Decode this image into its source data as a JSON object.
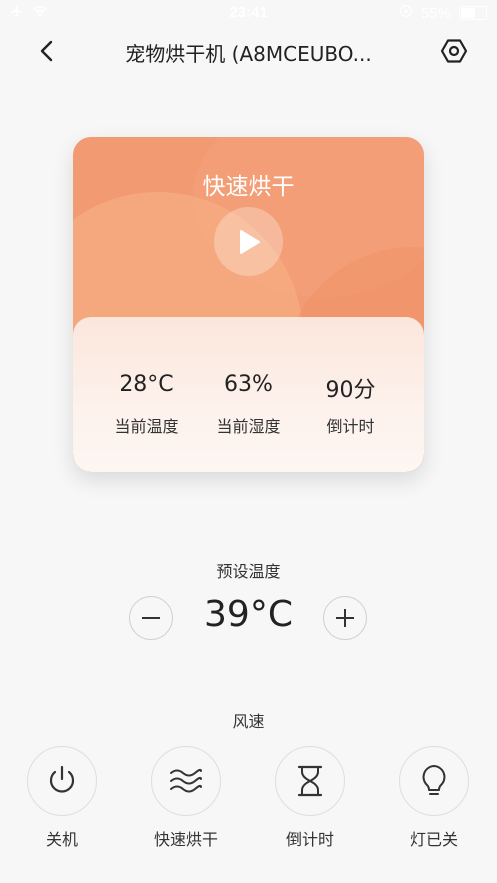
{
  "status_bar": {
    "time": "23:41",
    "battery_percent": "55%"
  },
  "header": {
    "title": "宠物烘干机 (A8MCEUBO..."
  },
  "card": {
    "mode_title": "快速烘干",
    "stats": [
      {
        "value": "28°C",
        "label": "当前温度"
      },
      {
        "value": "63%",
        "label": "当前湿度"
      },
      {
        "value": "90分",
        "label": "倒计时"
      }
    ]
  },
  "preset": {
    "label": "预设温度",
    "value": "39°C"
  },
  "wind": {
    "label": "风速"
  },
  "controls": [
    {
      "label": "关机",
      "icon": "power-icon"
    },
    {
      "label": "快速烘干",
      "icon": "wind-icon"
    },
    {
      "label": "倒计时",
      "icon": "hourglass-icon"
    },
    {
      "label": "灯已关",
      "icon": "bulb-icon"
    }
  ],
  "colors": {
    "card_accent": "#f29a72",
    "background": "#f7f7f7"
  }
}
